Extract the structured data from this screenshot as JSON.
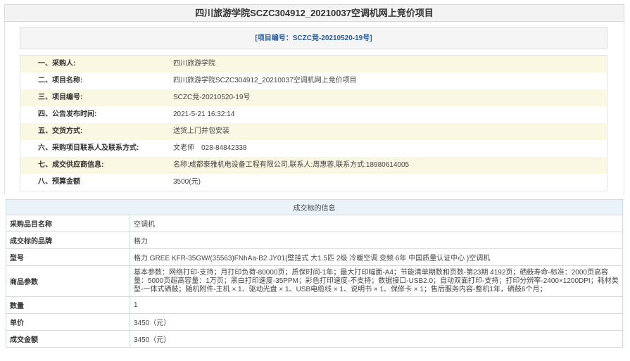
{
  "page_title": "四川旅游学院SCZC304912_20210037空调机网上竞价项目",
  "project_number_banner": "[项目编号：SCZC竞-20210520-19号]",
  "info_rows": [
    {
      "label": "一、采购人:",
      "value": "四川旅游学院"
    },
    {
      "label": "二、项目名称:",
      "value": "四川旅游学院SCZC304912_20210037空调机网上竞价项目"
    },
    {
      "label": "三、项目编号:",
      "value": "SCZC竞-20210520-19号"
    },
    {
      "label": "四、公告发布时间:",
      "value": "2021-5-21 16:32:14"
    },
    {
      "label": "五、交货方式:",
      "value": "送货上门并包安装"
    },
    {
      "label": "六、采购项目联系人及联系方式:",
      "value": "文老师　028-84842338"
    },
    {
      "label": "七、成交供应商信息:",
      "value": "名称:成都泰雅机电设备工程有限公司,联系人:周惠蓉,联系方式:18980614005"
    },
    {
      "label": "八、预算金额",
      "value": "3500(元)"
    }
  ],
  "deal_section": {
    "header": "成交标的信息",
    "rows": [
      {
        "label": "采购品目名称",
        "value": "空调机"
      },
      {
        "label": "成交标的品牌",
        "value": "格力"
      },
      {
        "label": "型号",
        "value": "格力 GREE KFR-35GW/(35563)FNhAa-B2 JY01(壁挂式 大1.5匹 2级 冷暖空调 变频 6年 中国质量认证中心 )空调机"
      },
      {
        "label": "商品参数",
        "value": "基本参数：网络打印-支持；月打印负荷-80000页；质保时间-1年；最大打印幅面-A4；节能清单期数和页数-第23期 4192页；硒鼓寿命-标准：2000页高容量：5000页超高容量：1万页；黑白打印速度-35PPM；彩色打印速度-不支持；数据接口-USB2.0；自动双面打印-支持；打印分辨率-2400×1200DPI；耗材类型-一体式硒鼓；随机附件-主机 × 1、驱动光盘 × 1、USB电缆线 × 1、说明书 × 1、保修卡 × 1；售后服务内容-整机1年，硒鼓6个月；"
      },
      {
        "label": "数量",
        "value": "1"
      },
      {
        "label": "单价",
        "value": "3450（元）"
      },
      {
        "label": "成交金额",
        "value": "3450（元）"
      }
    ]
  }
}
